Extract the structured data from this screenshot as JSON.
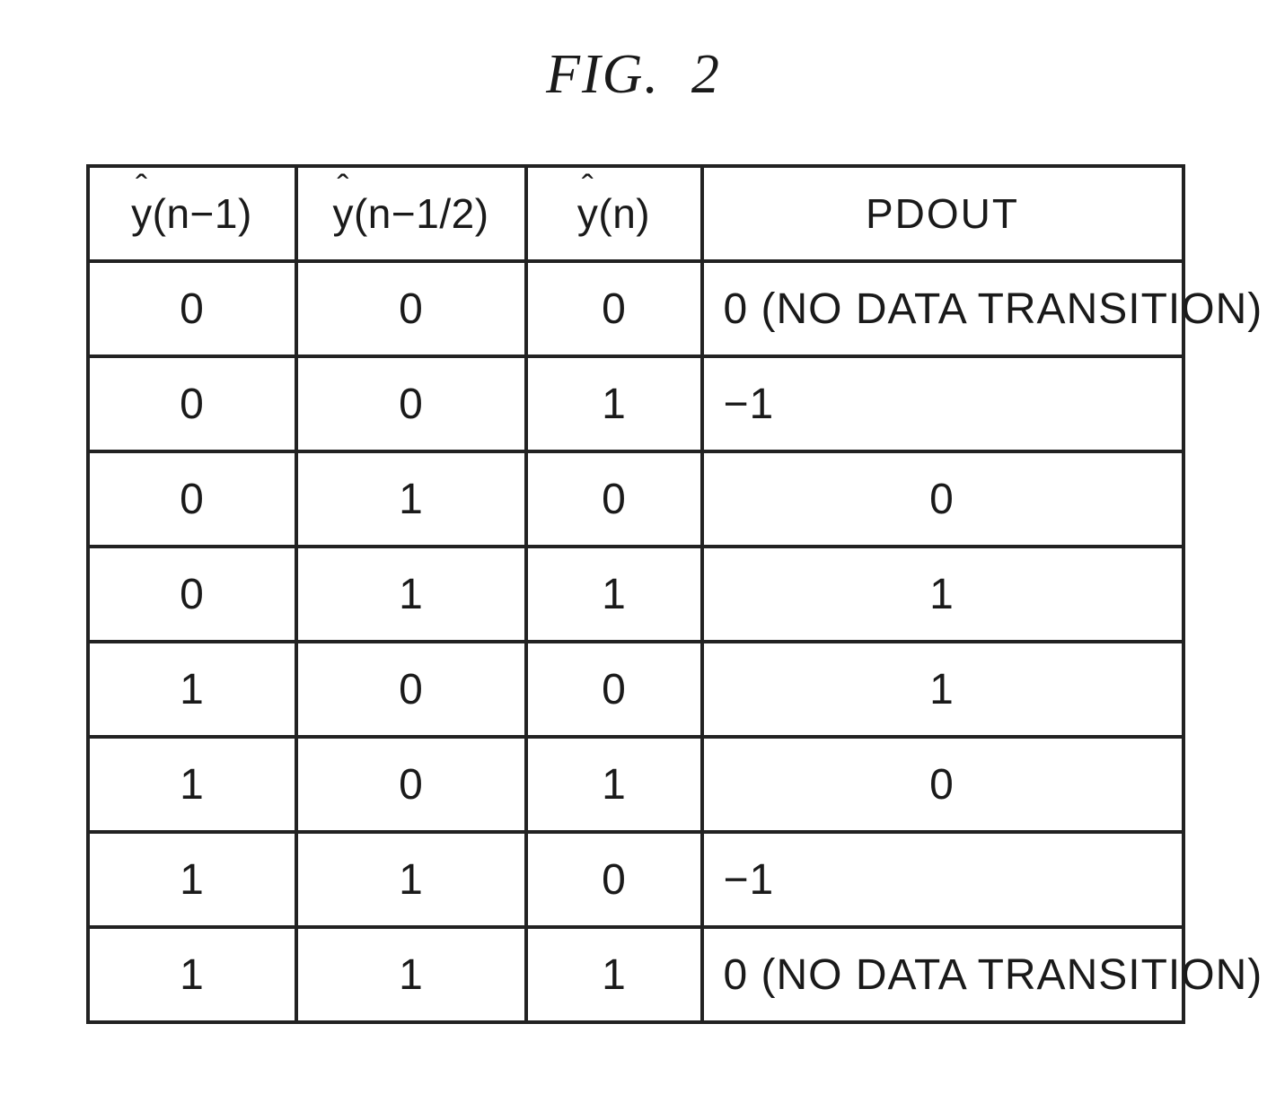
{
  "caption": {
    "prefix": "FIG.",
    "number": "2"
  },
  "headers": {
    "col1": {
      "base": "y",
      "arg": "(n−1)"
    },
    "col2": {
      "base": "y",
      "arg": "(n−1/2)"
    },
    "col3": {
      "base": "y",
      "arg": "(n)"
    },
    "col4": "PDOUT"
  },
  "rows": [
    {
      "a": "0",
      "b": "0",
      "c": "0",
      "pd": "0 (NO DATA TRANSITION)",
      "align": "left"
    },
    {
      "a": "0",
      "b": "0",
      "c": "1",
      "pd": "−1",
      "align": "left"
    },
    {
      "a": "0",
      "b": "1",
      "c": "0",
      "pd": "0",
      "align": "center"
    },
    {
      "a": "0",
      "b": "1",
      "c": "1",
      "pd": "1",
      "align": "center"
    },
    {
      "a": "1",
      "b": "0",
      "c": "0",
      "pd": "1",
      "align": "center"
    },
    {
      "a": "1",
      "b": "0",
      "c": "1",
      "pd": "0",
      "align": "center"
    },
    {
      "a": "1",
      "b": "1",
      "c": "0",
      "pd": "−1",
      "align": "left"
    },
    {
      "a": "1",
      "b": "1",
      "c": "1",
      "pd": "0 (NO DATA TRANSITION)",
      "align": "left"
    }
  ],
  "chart_data": {
    "type": "table",
    "title": "FIG. 2",
    "columns": [
      "ŷ(n−1)",
      "ŷ(n−1/2)",
      "ŷ(n)",
      "PDOUT"
    ],
    "rows": [
      [
        "0",
        "0",
        "0",
        "0 (NO DATA TRANSITION)"
      ],
      [
        "0",
        "0",
        "1",
        "−1"
      ],
      [
        "0",
        "1",
        "0",
        "0"
      ],
      [
        "0",
        "1",
        "1",
        "1"
      ],
      [
        "1",
        "0",
        "0",
        "1"
      ],
      [
        "1",
        "0",
        "1",
        "0"
      ],
      [
        "1",
        "1",
        "0",
        "−1"
      ],
      [
        "1",
        "1",
        "1",
        "0 (NO DATA TRANSITION)"
      ]
    ]
  }
}
